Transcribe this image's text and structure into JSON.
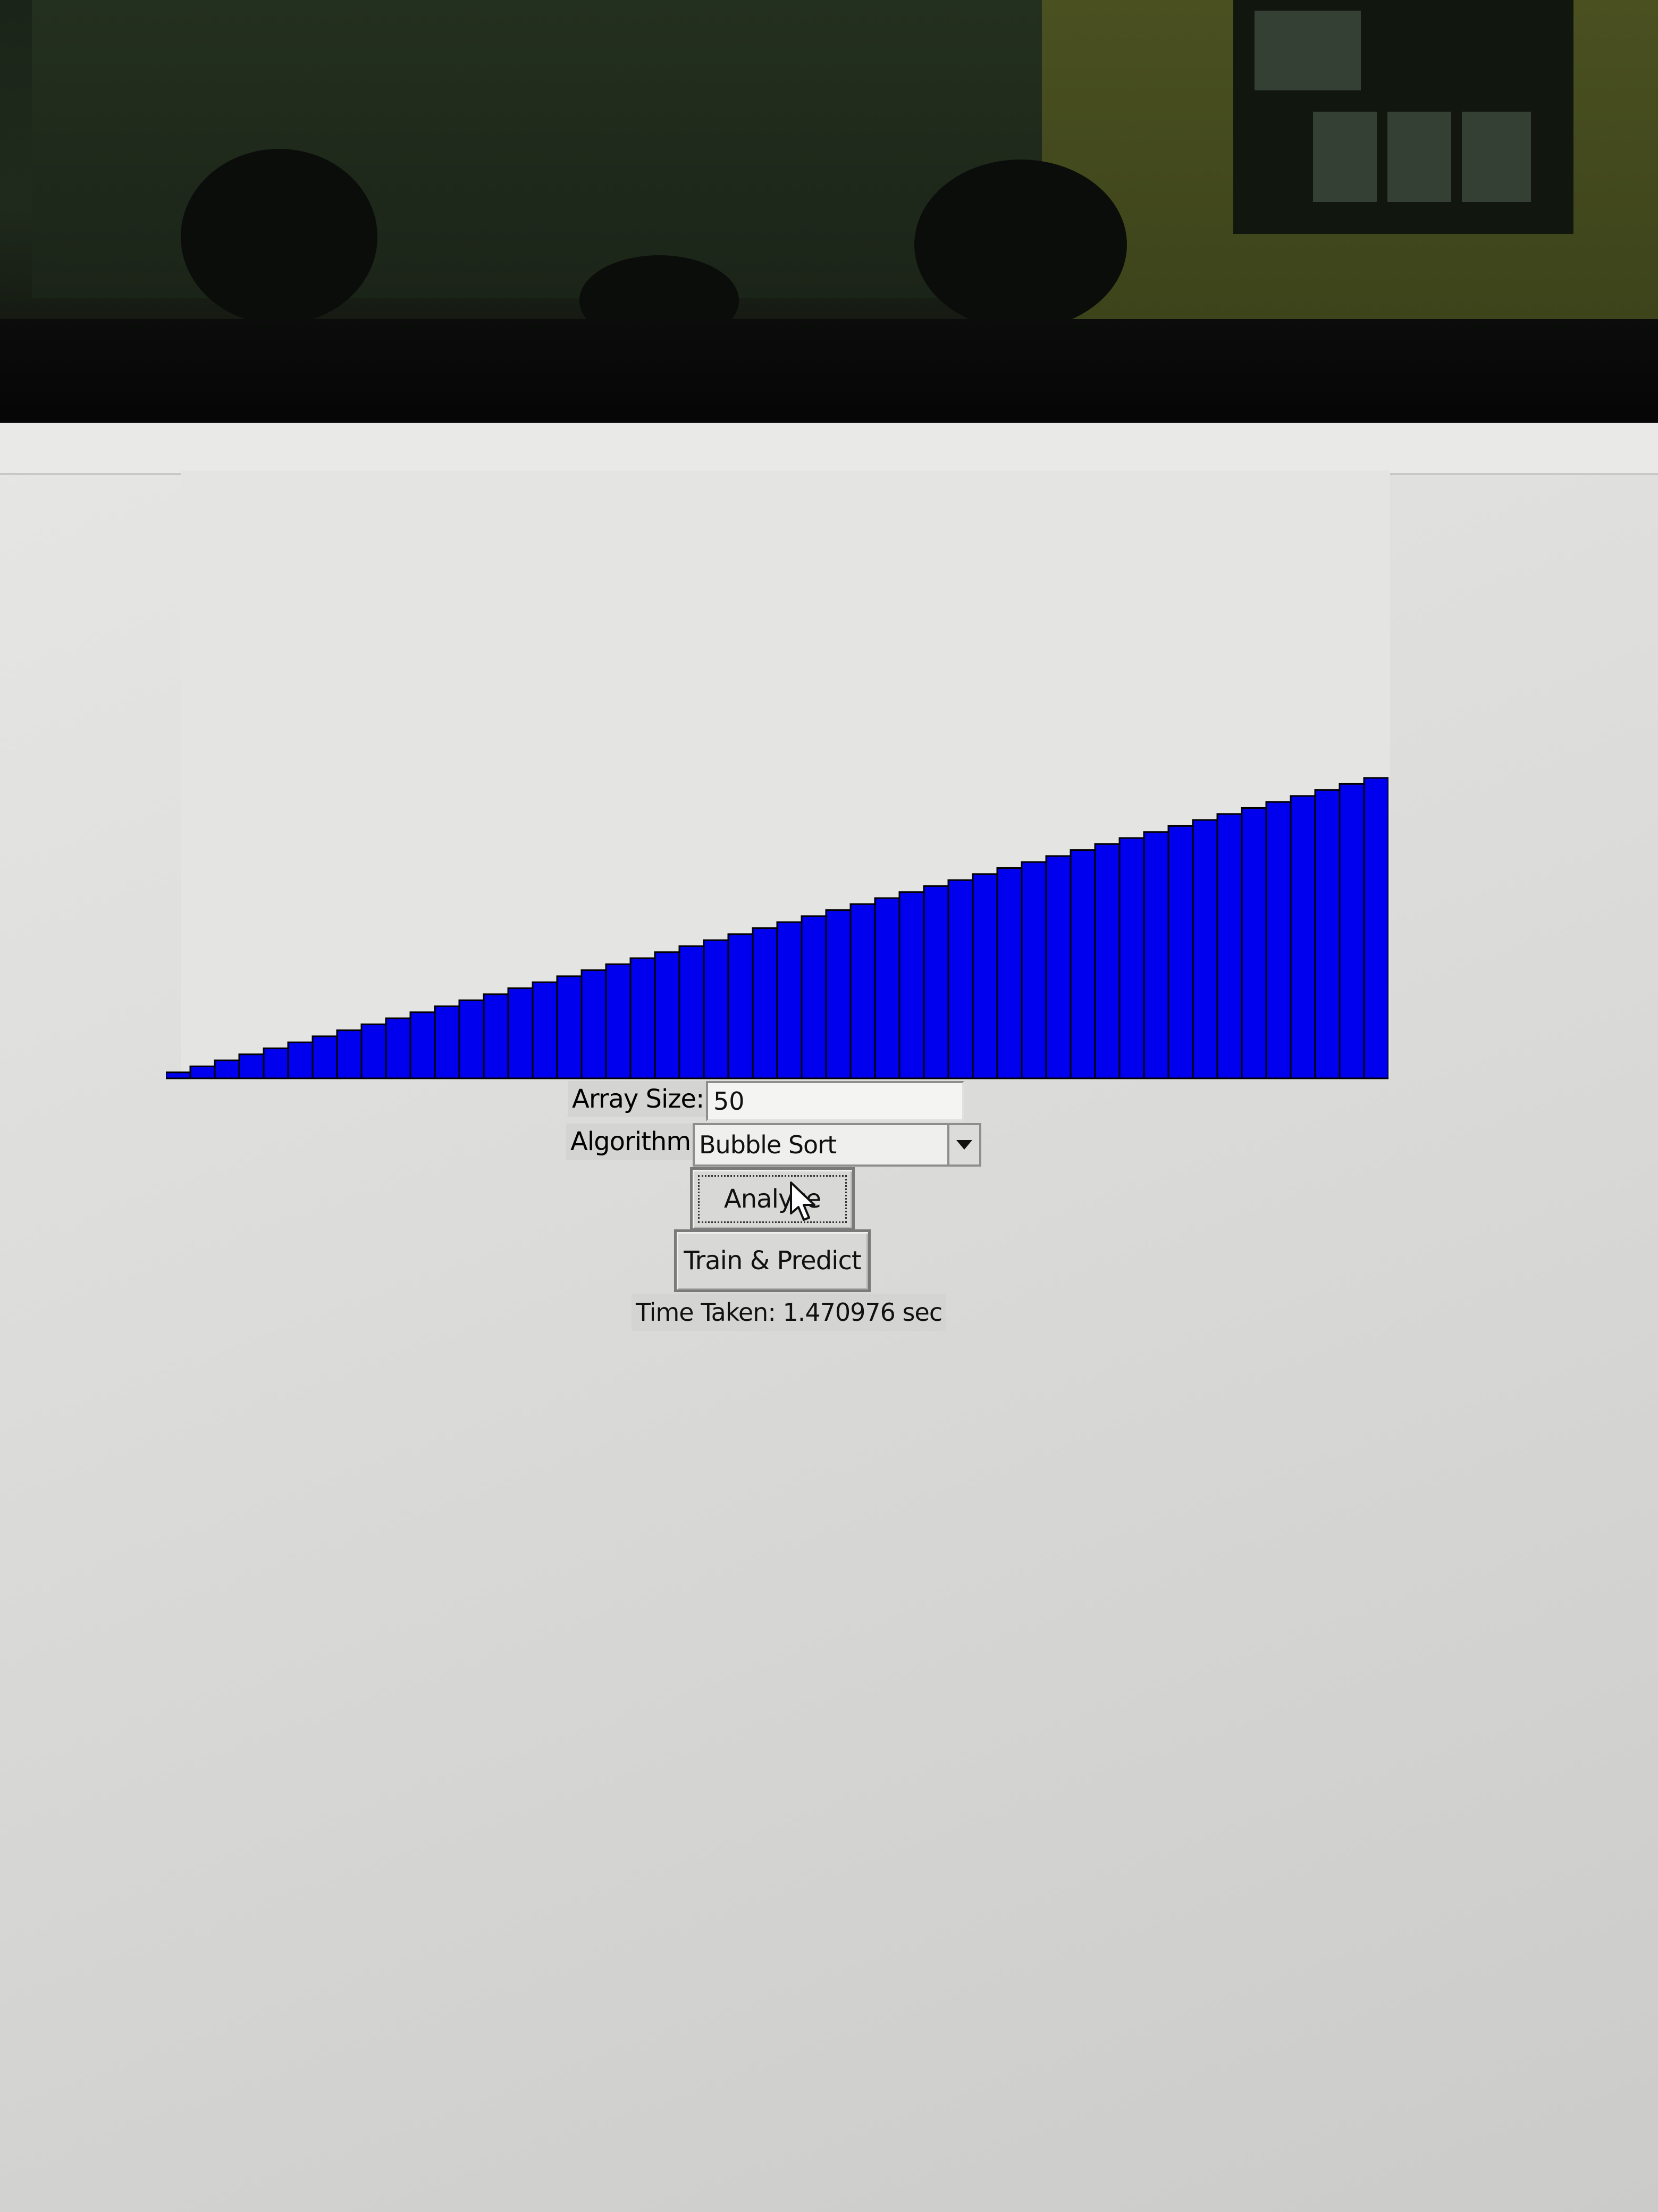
{
  "form": {
    "array_size_label": "Array Size:",
    "array_size_value": "50",
    "algorithm_label": "Algorithm:",
    "algorithm_selected": "Bubble Sort",
    "analyze_button": "Analyze",
    "train_predict_button": "Train & Predict",
    "time_taken": "Time Taken: 1.470976 sec"
  },
  "colors": {
    "bar_fill": "#0000ee",
    "bar_stroke": "#000000"
  },
  "chart_data": {
    "type": "bar",
    "values": [
      1,
      2,
      3,
      4,
      5,
      6,
      7,
      8,
      9,
      10,
      11,
      12,
      13,
      14,
      15,
      16,
      17,
      18,
      19,
      20,
      21,
      22,
      23,
      24,
      25,
      26,
      27,
      28,
      29,
      30,
      31,
      32,
      33,
      34,
      35,
      36,
      37,
      38,
      39,
      40,
      41,
      42,
      43,
      44,
      45,
      46,
      47,
      48,
      49,
      50
    ],
    "title": "",
    "xlabel": "",
    "ylabel": "",
    "grid": false
  }
}
